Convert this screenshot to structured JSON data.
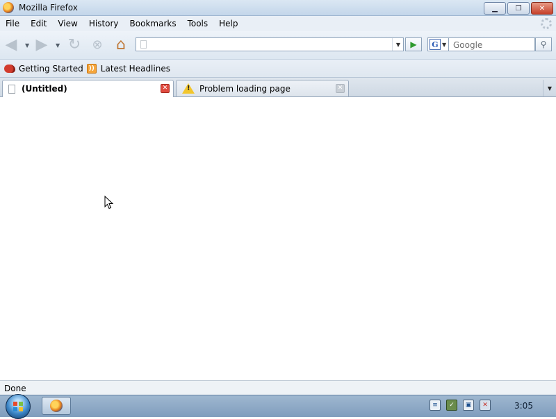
{
  "window": {
    "title": "Mozilla Firefox",
    "controls": {
      "minimize": "▁",
      "maximize": "❐",
      "close": "✕"
    }
  },
  "menu": {
    "items": [
      "File",
      "Edit",
      "View",
      "History",
      "Bookmarks",
      "Tools",
      "Help"
    ]
  },
  "navbar": {
    "back_icon": "back-arrow-icon",
    "forward_icon": "forward-arrow-icon",
    "reload_icon": "reload-icon",
    "stop_icon": "stop-icon",
    "home_icon": "home-icon",
    "url_value": "",
    "search_engine": "G",
    "search_placeholder": "Google"
  },
  "bookmarks": {
    "items": [
      {
        "label": "Getting Started",
        "icon": "firefox-bookmark-icon"
      },
      {
        "label": "Latest Headlines",
        "icon": "rss-feed-icon"
      }
    ]
  },
  "tabs": [
    {
      "label": "(Untitled)",
      "active": true,
      "icon": "page-icon"
    },
    {
      "label": "Problem loading page",
      "active": false,
      "icon": "warning-icon"
    }
  ],
  "status": {
    "text": "Done"
  },
  "taskbar": {
    "clock": "3:05",
    "tray_icons": [
      "notes-icon",
      "security-shield-icon",
      "network-icon",
      "volume-muted-icon"
    ]
  },
  "colors": {
    "titlebar": "#c3d6ea",
    "tab_close_active": "#e04b3f",
    "go_arrow": "#2e9a2e",
    "taskbar": "#7f9dbd"
  }
}
